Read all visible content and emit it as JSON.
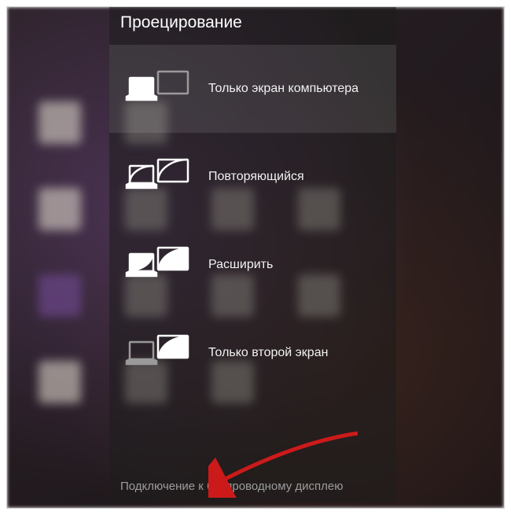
{
  "title": "Проецирование",
  "options": [
    {
      "label": "Только экран компьютера"
    },
    {
      "label": "Повторяющийся"
    },
    {
      "label": "Расширить"
    },
    {
      "label": "Только второй экран"
    }
  ],
  "wireless_link": "Подключение к беспроводному дисплею"
}
